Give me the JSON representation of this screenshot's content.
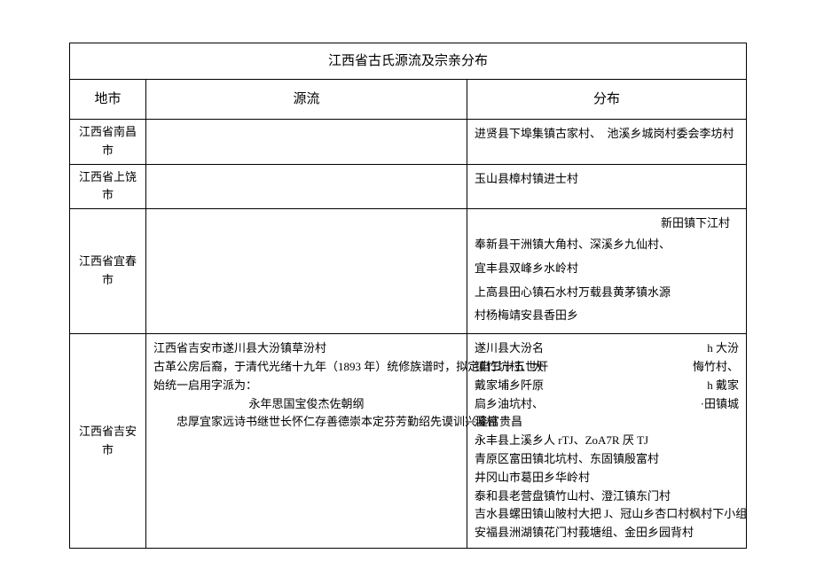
{
  "title": "江西省古氏源流及宗亲分布",
  "headers": {
    "region": "地市",
    "origin": "源流",
    "distribution": "分布"
  },
  "rows": [
    {
      "region": "江西省南昌市",
      "origin": "",
      "dist_lines": [
        {
          "l": "进贤县下埠集镇古家村、　池溪乡城岗村委会李坊村"
        }
      ]
    },
    {
      "region": "江西省上饶市",
      "origin": "",
      "dist_lines": [
        {
          "l": "玉山县樟村镇进士村"
        }
      ]
    },
    {
      "region": "江西省宜春市",
      "origin": "",
      "dist_lines": [
        {
          "r_only": "新田镇下江村"
        },
        {
          "l": "奉新县干洲镇大角村、深溪乡九仙村、"
        },
        {
          "l": "宜丰县双峰乡水岭村"
        },
        {
          "l": "上高县田心镇石水村万载县黄茅镇水源"
        },
        {
          "l": "村杨梅靖安县香田乡"
        }
      ]
    },
    {
      "region": "江西省吉安市",
      "origin_lines": [
        "江西省吉安市遂川县大汾镇草汾村",
        "古革公房后裔，于清代光绪十九年（1893 年）统修族谱时，拟定自三十五世开",
        "始统一启用字派为：",
        "永年思国宝俊杰佐朝纲",
        "忠厚宜家远诗书继世长怀仁存善德崇本定芬芳勤绍先谟训兴隆富贵昌"
      ],
      "origin_indents": [
        false,
        false,
        false,
        true,
        true
      ],
      "origin_centers": [
        false,
        false,
        false,
        true,
        false
      ],
      "dist_lines": [
        {
          "l": "遂川县大汾名",
          "r": "h 大汾"
        },
        {
          "l": "镇竹坑村、大",
          "r": "悔竹村、"
        },
        {
          "l": "戴家埔乡阡原",
          "r": "h 戴家"
        },
        {
          "l": "扃乡油坑村、",
          "r": "·田镇城"
        },
        {
          "l": "溪村"
        },
        {
          "l": "永丰县上溪乡人 rTJ、ZoA7R 厌 TJ"
        },
        {
          "l": "青原区富田镇北坑村、东固镇殷富村"
        },
        {
          "l": "井冈山市葛田乡华岭村"
        },
        {
          "l": "泰和县老营盘镇竹山村、澄江镇东门村"
        },
        {
          "l": "吉水县螺田镇山陂村大把 J、冠山乡杏口村枫村下小组"
        },
        {
          "l": "安福县洲湖镇花门村莪塘组、金田乡园背村"
        }
      ]
    }
  ]
}
